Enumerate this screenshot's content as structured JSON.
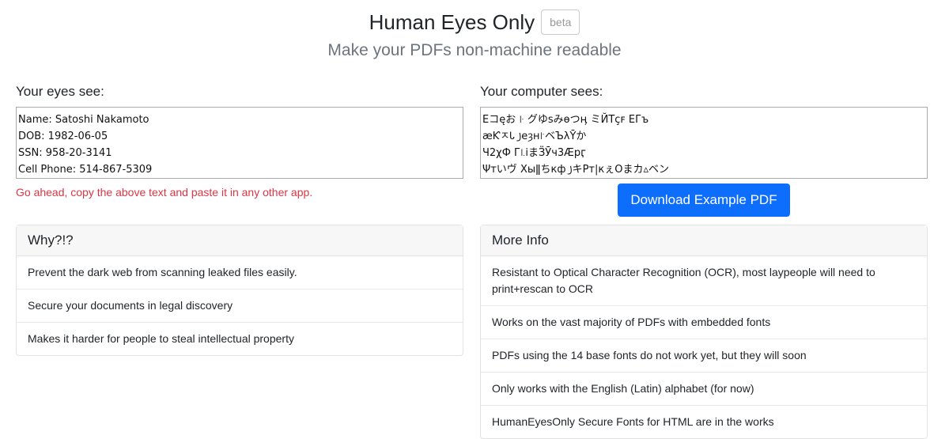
{
  "header": {
    "title": "Human Eyes Only",
    "badge": "beta",
    "subtitle": "Make your PDFs non-machine readable"
  },
  "left": {
    "label": "Your eyes see:",
    "text": "Name: Satoshi Nakamoto\nDOB: 1982-06-05\nSSN: 958-20-3141\nCell Phone: 514-867-5309",
    "note": "Go ahead, copy the above text and paste it in any other app."
  },
  "right": {
    "label": "Your computer sees:",
    "text": "Eコęお ꜏ グゆsみɵつӊ ミЙТçꜰ ЕГъ\næƘㅈᏓ ꠸eȝн꜎ベЪλȲか\nЧ2χФ Г꜑iまӞӮч3Æрӷ\nΨтいヴ Хыǁちкф ꠸キPт|кぇОまカ▵ベン",
    "button": "Download Example PDF"
  },
  "why": {
    "title": "Why?!?",
    "items": [
      "Prevent the dark web from scanning leaked files easily.",
      "Secure your documents in legal discovery",
      "Makes it harder for people to steal intellectual property"
    ]
  },
  "info": {
    "title": "More Info",
    "items": [
      "Resistant to Optical Character Recognition (OCR), most laypeople will need to print+rescan to OCR",
      "Works on the vast majority of PDFs with embedded fonts",
      "PDFs using the 14 base fonts do not work yet, but they will soon",
      "Only works with the English (Latin) alphabet (for now)",
      "HumanEyesOnly Secure Fonts for HTML are in the works"
    ]
  }
}
